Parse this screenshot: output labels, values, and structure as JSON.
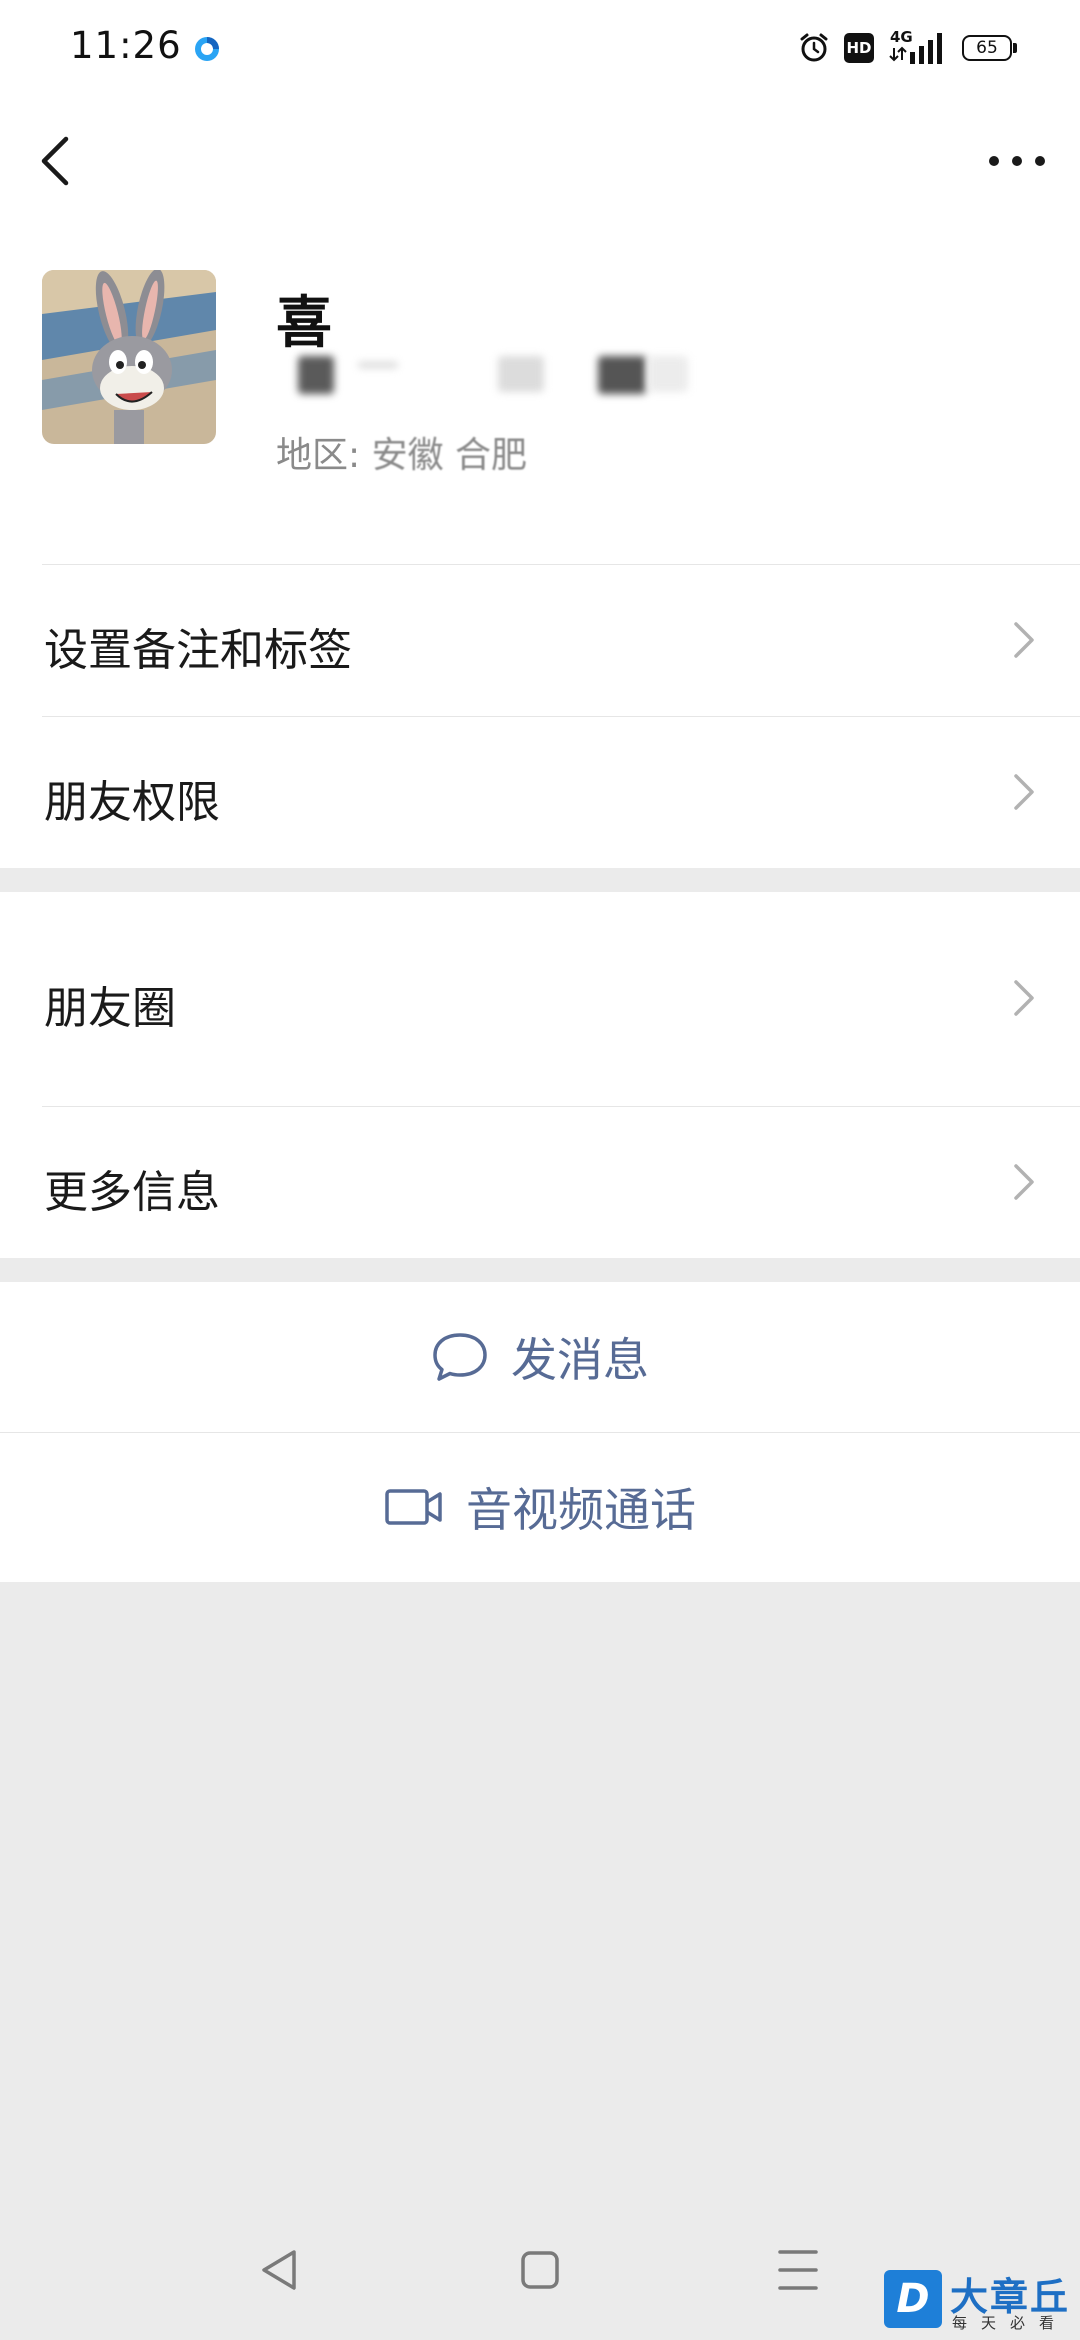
{
  "status_bar": {
    "time": "11:26",
    "signal_label": "4G",
    "battery": "65",
    "hd_label": "HD",
    "icons": [
      "app-notification-icon",
      "alarm-icon",
      "hd-icon",
      "signal-icon",
      "battery-icon"
    ]
  },
  "nav": {
    "back_icon": "chevron-left-icon",
    "more_icon": "more-dots-icon"
  },
  "profile": {
    "name": "喜",
    "region_label": "地区:",
    "region_value": "安徽  合肥"
  },
  "menu": {
    "items": [
      {
        "label": "设置备注和标签"
      },
      {
        "label": "朋友权限"
      },
      {
        "label": "朋友圈"
      },
      {
        "label": "更多信息"
      }
    ]
  },
  "actions": {
    "message_label": "发消息",
    "call_label": "音视频通话"
  },
  "watermark": {
    "logo": "D",
    "title": "大章丘",
    "subtitle": "每天必看"
  },
  "colors": {
    "link": "#576b95",
    "background": "#ebebeb",
    "surface": "#ffffff"
  }
}
